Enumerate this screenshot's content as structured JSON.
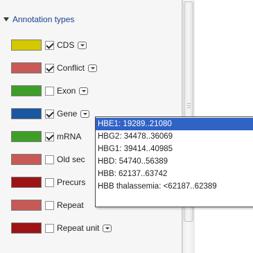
{
  "section": {
    "title": "Annotation types",
    "expanded": true
  },
  "annotation_types": [
    {
      "label": "CDS",
      "color": "#d4c800",
      "checked": true
    },
    {
      "label": "Conflict",
      "color": "#c75a57",
      "checked": true
    },
    {
      "label": "Exon",
      "color": "#3e9e28",
      "checked": false
    },
    {
      "label": "Gene",
      "color": "#1a57a0",
      "checked": true
    },
    {
      "label": "mRNA",
      "color": "#3e9e28",
      "checked": true
    },
    {
      "label": "Old sec",
      "color": "#c75a57",
      "checked": false
    },
    {
      "label": "Precurs",
      "color": "#9c1414",
      "checked": false
    },
    {
      "label": "Repeat",
      "color": "#c75a57",
      "checked": false
    },
    {
      "label": "Repeat unit",
      "color": "#9c1414",
      "checked": false
    }
  ],
  "popup": {
    "selected_index": 0,
    "items": [
      "HBE1: 19289..21080",
      "HBG2: 34478..36069",
      "HBG1: 39414..40985",
      "HBD: 54740..56389",
      "HBB: 62137..63742",
      "HBB thalassemia: <62187..62389"
    ]
  },
  "icons": {
    "expand": "triangle-down-icon",
    "dropdown": "dropdown-arrow-icon",
    "check": "checkmark-icon"
  }
}
